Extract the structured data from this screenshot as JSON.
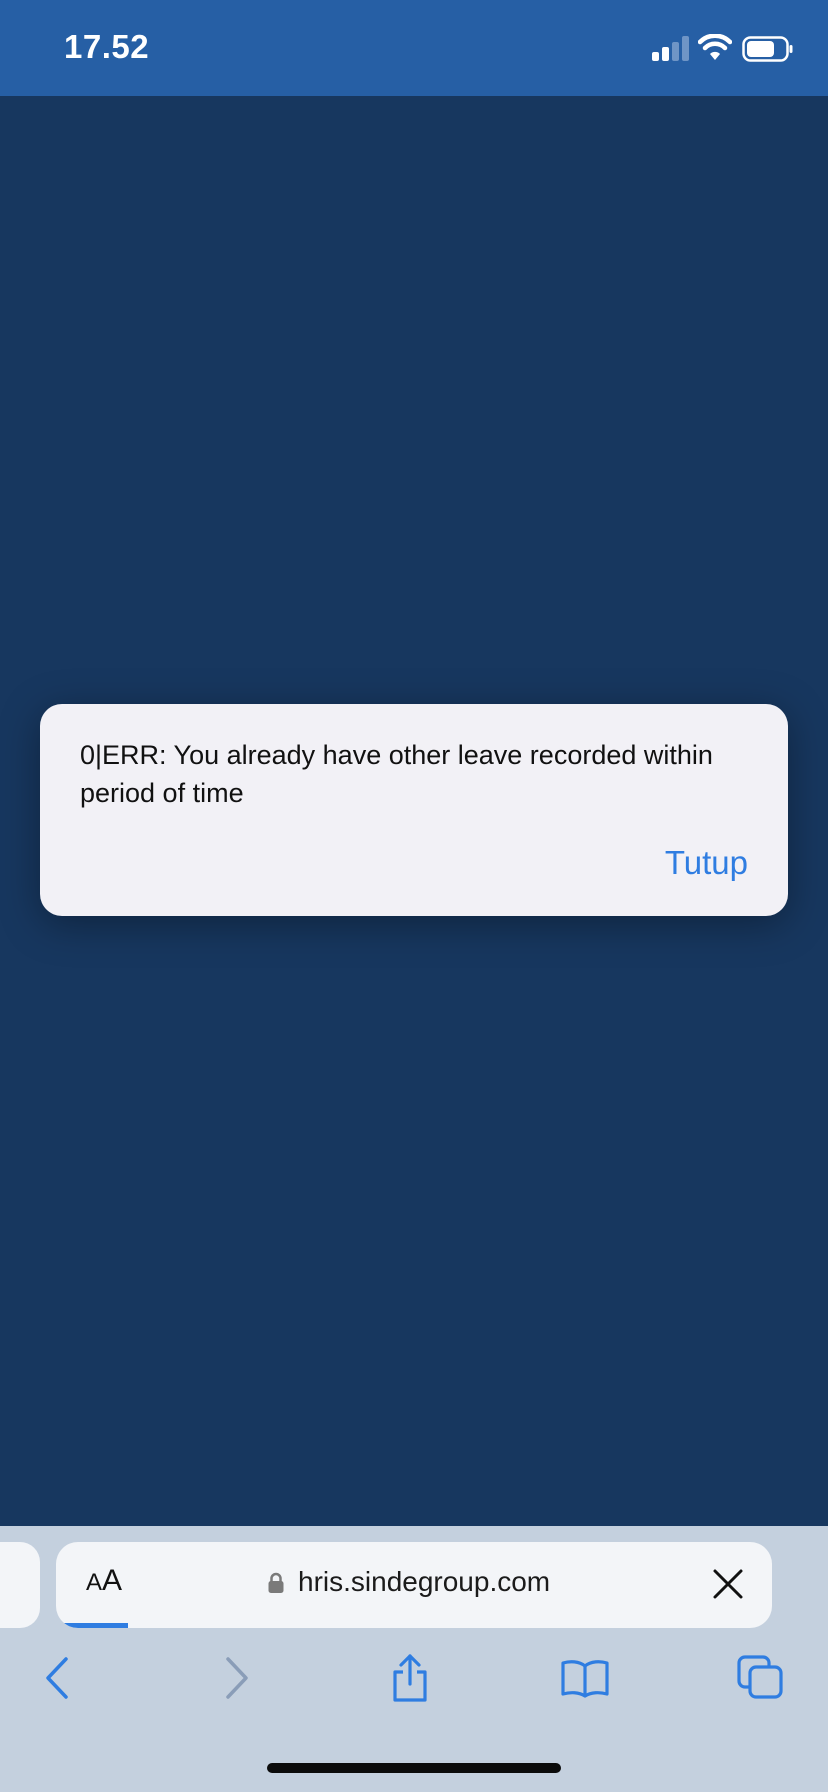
{
  "status_bar": {
    "time": "17.52",
    "background": "#265fa5",
    "icons": [
      "signal-icon",
      "wifi-icon",
      "battery-icon"
    ]
  },
  "page": {
    "background": "#17375f"
  },
  "alert": {
    "message": "0|ERR: You already have other leave recorded within period of time",
    "button_label": "Tutup",
    "accent": "#2f7de1"
  },
  "browser": {
    "reader_label_small": "A",
    "reader_label_large": "A",
    "url": "hris.sindegroup.com",
    "secure": true,
    "load_progress_fraction": 0.1,
    "toolbar_icons": [
      "back-icon",
      "forward-icon",
      "share-icon",
      "bookmarks-icon",
      "tabs-icon"
    ]
  }
}
